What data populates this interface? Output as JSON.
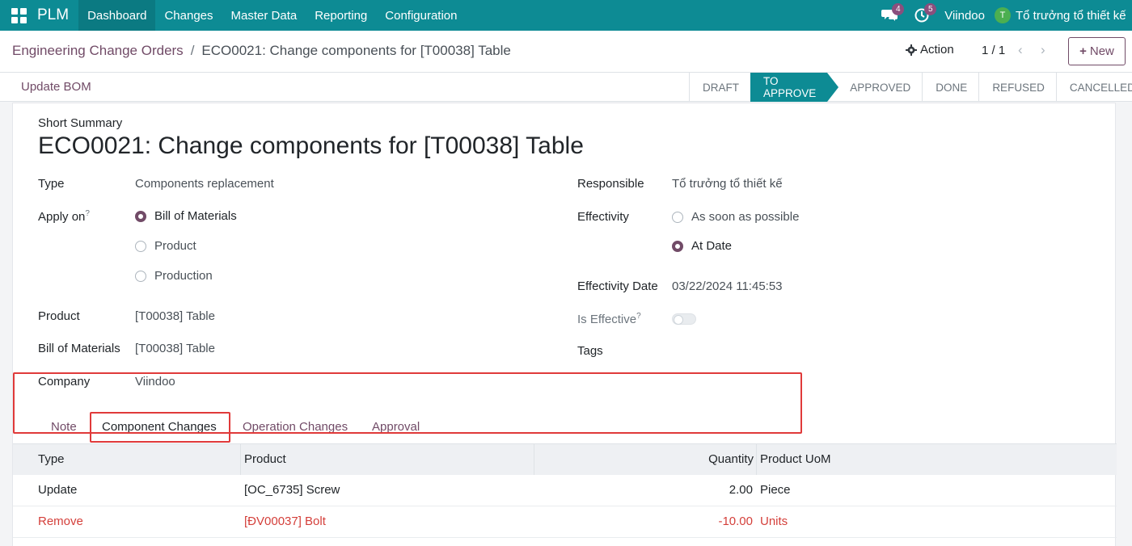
{
  "navbar": {
    "brand": "PLM",
    "menu": [
      "Dashboard",
      "Changes",
      "Master Data",
      "Reporting",
      "Configuration"
    ],
    "messages_count": "4",
    "activities_count": "5",
    "company": "Viindoo",
    "user_initial": "T",
    "user_name": "Tổ trưởng tổ thiết kế"
  },
  "breadcrumb": {
    "parent": "Engineering Change Orders",
    "separator": "/",
    "current": "ECO0021: Change components for [T00038] Table"
  },
  "control": {
    "action_label": "Action",
    "pager": "1 / 1",
    "new_label": "New"
  },
  "statusbar": {
    "button": "Update BOM",
    "stages": [
      "DRAFT",
      "TO APPROVE",
      "APPROVED",
      "DONE",
      "REFUSED",
      "CANCELLED"
    ],
    "current_stage": "TO APPROVE"
  },
  "form": {
    "summary_label": "Short Summary",
    "title": "ECO0021: Change components for [T00038] Table",
    "type_label": "Type",
    "type_value": "Components replacement",
    "apply_on_label": "Apply on",
    "apply_on_options": [
      "Bill of Materials",
      "Product",
      "Production"
    ],
    "apply_on_selected": "Bill of Materials",
    "product_label": "Product",
    "product_value": "[T00038] Table",
    "bom_label": "Bill of Materials",
    "bom_value": "[T00038] Table",
    "company_label": "Company",
    "company_value": "Viindoo",
    "responsible_label": "Responsible",
    "responsible_value": "Tổ trưởng tổ thiết kế",
    "effectivity_label": "Effectivity",
    "effectivity_options": [
      "As soon as possible",
      "At Date"
    ],
    "effectivity_selected": "At Date",
    "effectivity_date_label": "Effectivity Date",
    "effectivity_date_value": "03/22/2024 11:45:53",
    "is_effective_label": "Is Effective",
    "is_effective": false,
    "tags_label": "Tags",
    "help_mark": "?"
  },
  "tabs": [
    "Note",
    "Component Changes",
    "Operation Changes",
    "Approval"
  ],
  "active_tab": "Component Changes",
  "table": {
    "columns": [
      "Type",
      "Product",
      "Quantity",
      "Product UoM"
    ],
    "rows": [
      {
        "type": "Update",
        "product": "[OC_6735] Screw",
        "quantity": "2.00",
        "uom": "Piece"
      },
      {
        "type": "Remove",
        "product": "[ĐV00037] Bolt",
        "quantity": "-10.00",
        "uom": "Units"
      }
    ]
  },
  "colors": {
    "navbar": "#0d8b94",
    "brand_purple": "#714b67",
    "highlight_red": "#e03a3a",
    "danger_text": "#d43f3a"
  }
}
